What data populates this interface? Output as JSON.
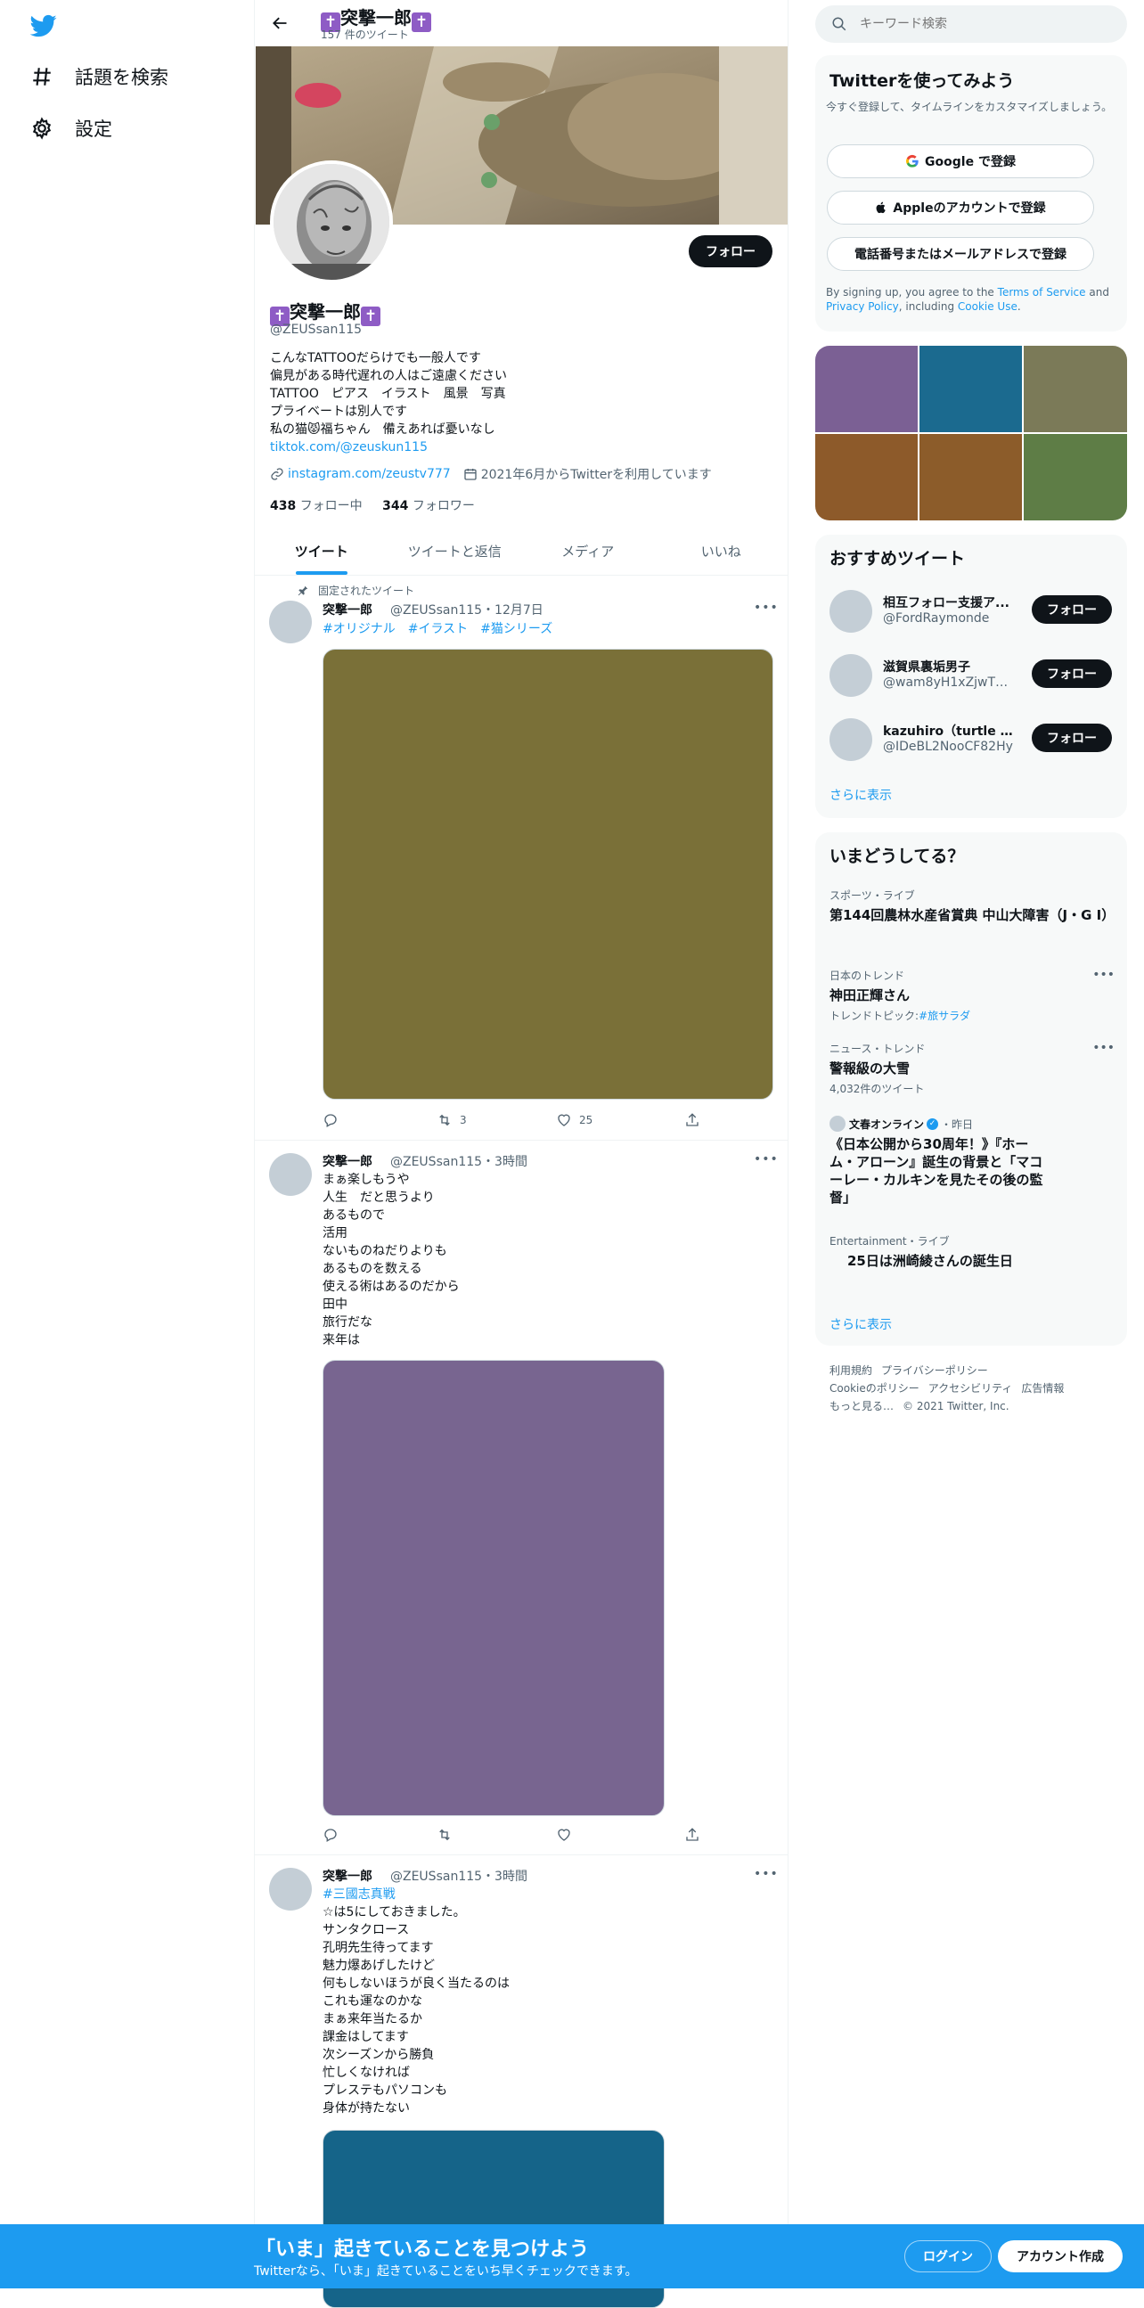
{
  "nav": {
    "items": [
      {
        "label": "話題を検索"
      },
      {
        "label": "設定"
      }
    ]
  },
  "header": {
    "name_cross_left": "✝️",
    "name": "突撃一郎",
    "name_cross_right": "✝️",
    "tweet_count": "157 件のツイート"
  },
  "profile": {
    "follow_label": "フォロー",
    "name": "突撃一郎",
    "handle": "@ZEUSsan115",
    "bio": "こんなTATTOOだらけでも一般人です\n偏見がある時代遅れの人はご遠慮ください\nTATTOO　ピアス　イラスト　風景　写真\nプライベートは別人です\n私の猫😾福ちゃん　備えあれば憂いなし",
    "bio_link": "tiktok.com/@zeuskun115",
    "website": "instagram.com/zeustv777",
    "joined": "2021年6月からTwitterを利用しています",
    "following_count": "438",
    "following_label": "フォロー中",
    "followers_count": "344",
    "followers_label": "フォロワー"
  },
  "tabs": [
    {
      "label": "ツイート"
    },
    {
      "label": "ツイートと返信"
    },
    {
      "label": "メディア"
    },
    {
      "label": "いいね"
    }
  ],
  "tweets": [
    {
      "pinned_label": "固定されたツイート",
      "name": "突撃一郎",
      "meta": "@ZEUSsan115・12月7日",
      "text": "#オリジナル　#イラスト　#猫シリーズ",
      "retweets": "3",
      "likes": "25",
      "media_color": "#7a7038"
    },
    {
      "name": "突撃一郎",
      "meta": "@ZEUSsan115・3時間",
      "text": "まぁ楽しもうや\n人生　だと思うより\nあるもので\n活用\nないものねだりよりも\nあるものを数える\n使える術はあるのだから\n田中\n旅行だな\n来年は",
      "media_color": "#786590"
    },
    {
      "name": "突撃一郎",
      "meta": "@ZEUSsan115・3時間",
      "hashtag": "#三國志真戦",
      "text": "☆は5にしておきました。\nサンタクロース\n孔明先生待ってます\n魅力爆あげしたけど\n何もしないほうが良く当たるのは\nこれも運なのかな\nまぁ来年当たるか\n課金はしてます\n次シーズンから勝負\n忙しくなければ\nプレステもパソコンも\n身体が持たない",
      "media_color": "#156489"
    }
  ],
  "search": {
    "placeholder": "キーワード検索"
  },
  "signup_card": {
    "title": "Twitterを使ってみよう",
    "subtitle": "今すぐ登録して、タイムラインをカスタマイズしましょう。",
    "google_label": "Google で登録",
    "apple_label": "Appleのアカウントで登録",
    "phone_label": "電話番号またはメールアドレスで登録",
    "terms_prefix": "By signing up, you agree to the",
    "terms_link": "Terms of Service",
    "terms_and": "and",
    "privacy_link": "Privacy Policy",
    "terms_including": ", including",
    "cookie_link": "Cookie Use",
    "terms_end": "."
  },
  "photo_colors": [
    "#7b6094",
    "#1b6a8f",
    "#7b7a58",
    "#8d5a2a",
    "#8c5c2a",
    "#5e7d46"
  ],
  "recommended": {
    "title": "おすすめツイート",
    "follow_label": "フォロー",
    "users": [
      {
        "name": "相互フォロー支援ア...",
        "handle": "@FordRaymonde"
      },
      {
        "name": "滋賀県裏垢男子",
        "handle": "@wam8yH1xZjwTW..."
      },
      {
        "name": "kazuhiro（turtle cats...",
        "handle": "@IDeBL2NooCF82Hy"
      }
    ],
    "show_more": "さらに表示"
  },
  "trends": {
    "title": "いまどうしてる？",
    "items": [
      {
        "category": "スポーツ・ライブ",
        "title": "第144回農林水産省賞典 中山大障害（J・G I）"
      },
      {
        "category": "日本のトレンド",
        "title": "神田正輝さん",
        "sub_prefix": "トレンドトピック:",
        "sub_link": "#旅サラダ"
      },
      {
        "category": "ニュース・トレンド",
        "title": "警報級の大雪",
        "sub": "4,032件のツイート"
      },
      {
        "source": "文春オンライン",
        "time": "・昨日",
        "title": "《日本公開から30周年！》『ホーム・アローン』誕生の背景と「マコーレー・カルキンを見たその後の監督」"
      },
      {
        "category": "Entertainment・ライブ",
        "title": "25日は洲崎綾さんの誕生日"
      }
    ],
    "show_more": "さらに表示"
  },
  "footer": {
    "links": [
      "利用規約",
      "プライバシーポリシー",
      "Cookieのポリシー",
      "アクセシビリティ",
      "広告情報",
      "もっと見る…",
      "© 2021 Twitter, Inc."
    ]
  },
  "bottom_bar": {
    "title": "「いま」起きていることを見つけよう",
    "subtitle": "Twitterなら、「いま」起きていることをいち早くチェックできます。",
    "login_label": "ログイン",
    "signup_label": "アカウント作成"
  },
  "colors": {
    "accent": "#1d9bf0",
    "dark_button": "#0f1419",
    "cross_purple": "#8e5cc5"
  }
}
